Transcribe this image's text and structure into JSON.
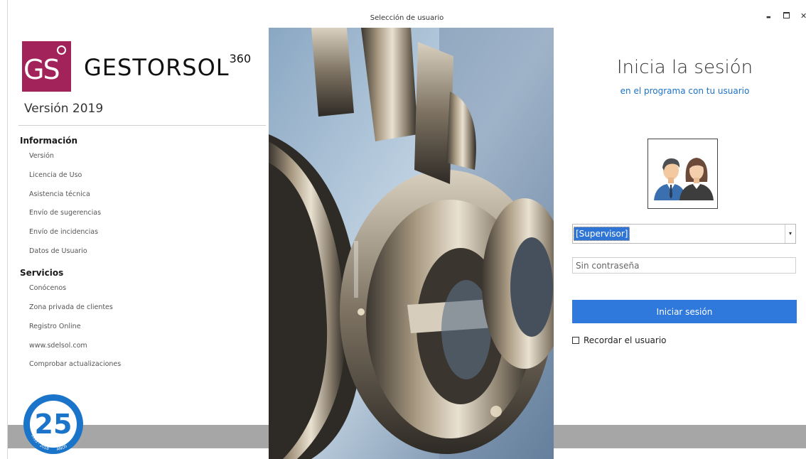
{
  "window": {
    "title": "Selección de usuario",
    "minimize_glyph": "▬",
    "close_glyph": "✕"
  },
  "brand": {
    "logo_letters": "GS",
    "name": "GESTORSOL",
    "superscript": "360",
    "version": "Versión 2019",
    "logo_color": "#a1235a"
  },
  "sections": {
    "info": {
      "title": "Información",
      "items": [
        "Versión",
        "Licencia de Uso",
        "Asistencia técnica",
        "Envío de sugerencias",
        "Envío de incidencias",
        "Datos de Usuario"
      ]
    },
    "services": {
      "title": "Servicios",
      "items": [
        "Conócenos",
        "Zona privada de clientes",
        "Registro Online",
        "www.sdelsol.com",
        "Comprobar actualizaciones"
      ]
    }
  },
  "badge": {
    "number": "25",
    "left_text": "1993 - 2018",
    "right_text": "AÑOS",
    "color": "#1a74c9"
  },
  "login": {
    "title": "Inicia la sesión",
    "subtitle": "en el programa con tu usuario",
    "user_selected": "[Supervisor]",
    "password_placeholder": "Sin contraseña",
    "button_label": "Iniciar sesión",
    "remember_label": "Recordar el usuario",
    "remember_checked": false,
    "accent_color": "#2f79dd",
    "subtitle_color": "#1c73c6"
  }
}
